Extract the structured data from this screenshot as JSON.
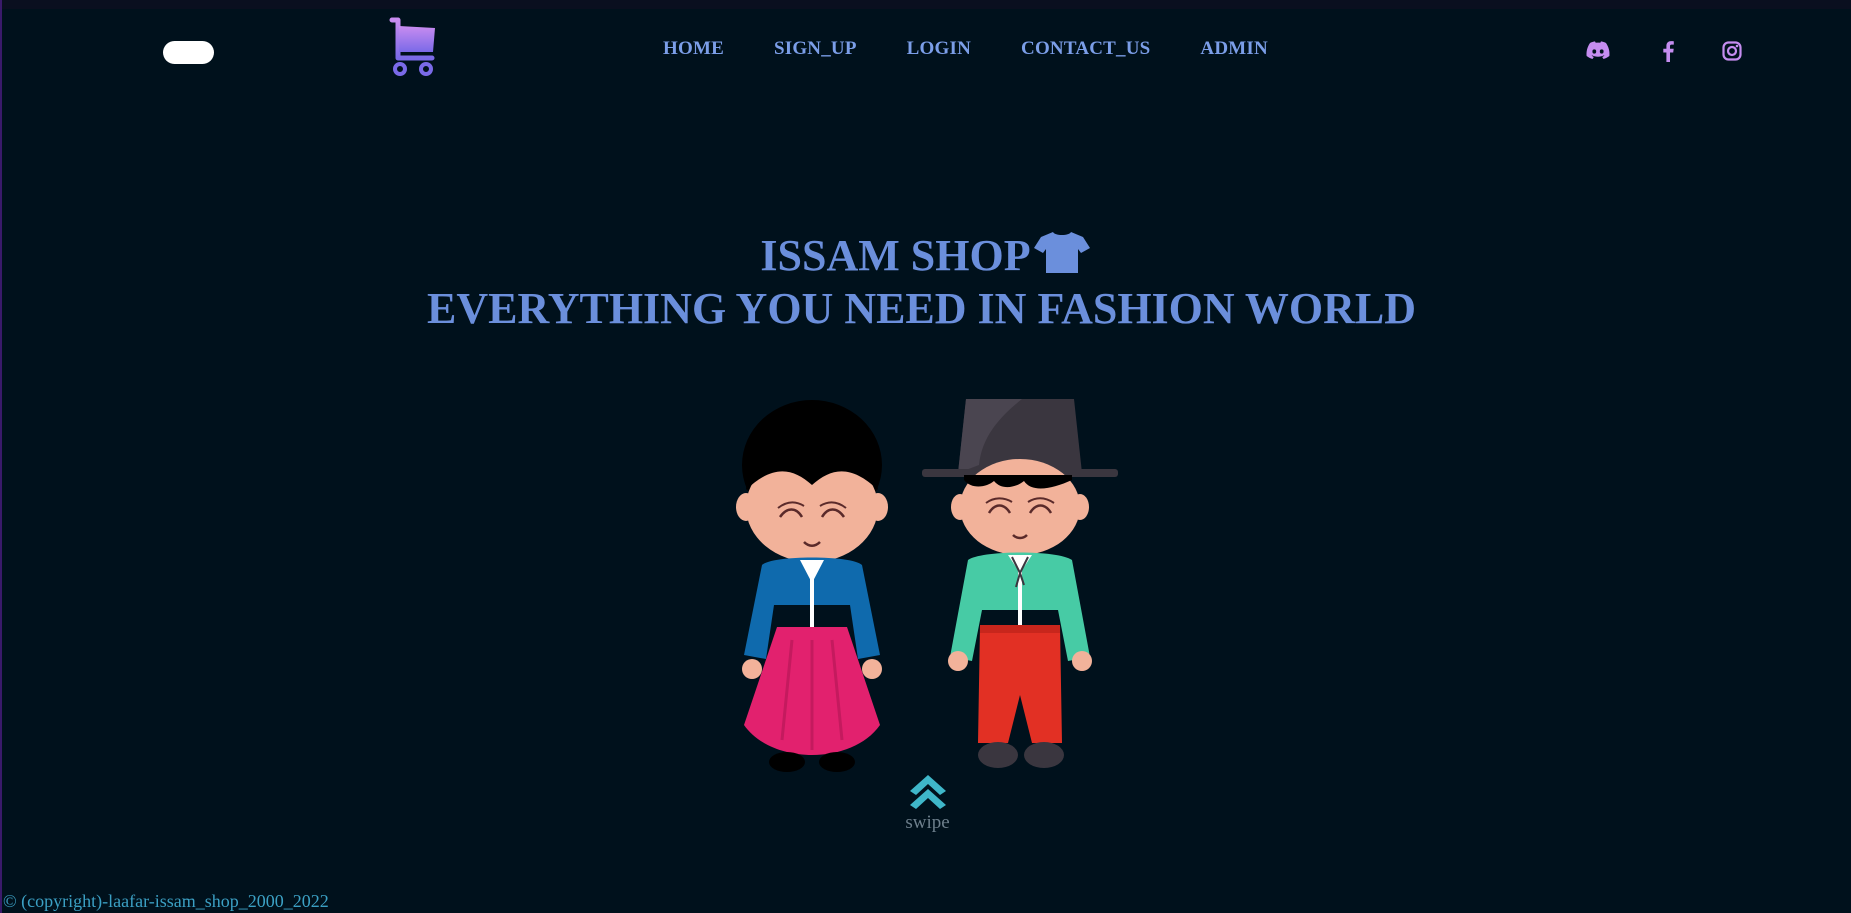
{
  "nav": {
    "items": [
      "HOME",
      "SIGN_UP",
      "LOGIN",
      "CONTACT_US",
      "ADMIN"
    ]
  },
  "socials": [
    "discord-icon",
    "facebook-icon",
    "instagram-icon"
  ],
  "hero": {
    "title": "ISSAM SHOP",
    "subtitle": "EVERYTHING YOU NEED IN FASHION WORLD"
  },
  "swipe": {
    "label": "swipe"
  },
  "footer": {
    "copyright": "© (copyright)-laafar-issam_shop_2000_2022"
  },
  "colors": {
    "background": "#00111c",
    "nav_text": "#7b9ee8",
    "hero_text": "#6b8fdc",
    "social_icon": "#c58df0",
    "swipe_arrow": "#3fb7c9",
    "copyright": "#3ba0c4"
  }
}
